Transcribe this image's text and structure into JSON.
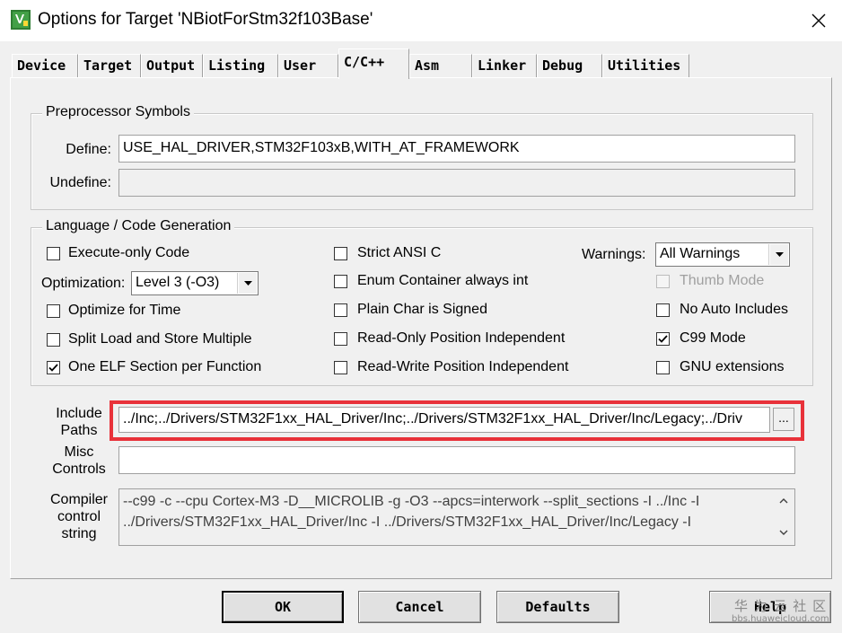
{
  "window": {
    "title": "Options for Target 'NBiotForStm32f103Base'",
    "close_glyph": "✕"
  },
  "tabs": [
    {
      "label": "Device"
    },
    {
      "label": "Target"
    },
    {
      "label": "Output"
    },
    {
      "label": "Listing"
    },
    {
      "label": "User"
    },
    {
      "label": "C/C++"
    },
    {
      "label": "Asm"
    },
    {
      "label": "Linker"
    },
    {
      "label": "Debug"
    },
    {
      "label": "Utilities"
    }
  ],
  "active_tab": "C/C++",
  "preprocessor": {
    "group_label": "Preprocessor Symbols",
    "define_label": "Define:",
    "define_value": "USE_HAL_DRIVER,STM32F103xB,WITH_AT_FRAMEWORK",
    "undefine_label": "Undefine:",
    "undefine_value": ""
  },
  "language": {
    "group_label": "Language / Code Generation",
    "execute_only": {
      "label": "Execute-only Code",
      "checked": false
    },
    "optimization_label": "Optimization:",
    "optimization_value": "Level 3 (-O3)",
    "optimize_time": {
      "label": "Optimize for Time",
      "checked": false
    },
    "split_load": {
      "label": "Split Load and Store Multiple",
      "checked": false
    },
    "one_elf": {
      "label": "One ELF Section per Function",
      "checked": true
    },
    "strict_ansi": {
      "label": "Strict ANSI C",
      "checked": false
    },
    "enum_container": {
      "label": "Enum Container always int",
      "checked": false
    },
    "plain_char": {
      "label": "Plain Char is Signed",
      "checked": false
    },
    "ro_pos_indep": {
      "label": "Read-Only Position Independent",
      "checked": false
    },
    "rw_pos_indep": {
      "label": "Read-Write Position Independent",
      "checked": false
    },
    "warnings_label": "Warnings:",
    "warnings_value": "All Warnings",
    "thumb_mode": {
      "label": "Thumb Mode",
      "checked": false,
      "disabled": true
    },
    "no_auto_includes": {
      "label": "No Auto Includes",
      "checked": false
    },
    "c99_mode": {
      "label": "C99 Mode",
      "checked": true
    },
    "gnu_extensions": {
      "label": "GNU extensions",
      "checked": false
    }
  },
  "include": {
    "label_line1": "Include",
    "label_line2": "Paths",
    "value": "../Inc;../Drivers/STM32F1xx_HAL_Driver/Inc;../Drivers/STM32F1xx_HAL_Driver/Inc/Legacy;../Driv",
    "browse_label": "..."
  },
  "misc": {
    "label_line1": "Misc",
    "label_line2": "Controls",
    "value": ""
  },
  "compiler": {
    "label_line1": "Compiler",
    "label_line2": "control",
    "label_line3": "string",
    "line1": "--c99 -c --cpu Cortex-M3 -D__MICROLIB -g -O3 --apcs=interwork --split_sections -I ../Inc -I",
    "line2": "../Drivers/STM32F1xx_HAL_Driver/Inc -I ../Drivers/STM32F1xx_HAL_Driver/Inc/Legacy -I"
  },
  "buttons": {
    "ok": "OK",
    "cancel": "Cancel",
    "defaults": "Defaults",
    "help": "Help"
  },
  "watermark": {
    "cn": "华 为 云 社 区",
    "url": "bbs.huaweicloud.com"
  },
  "colors": {
    "highlight": "#e8323a",
    "face": "#f0f0f0"
  }
}
